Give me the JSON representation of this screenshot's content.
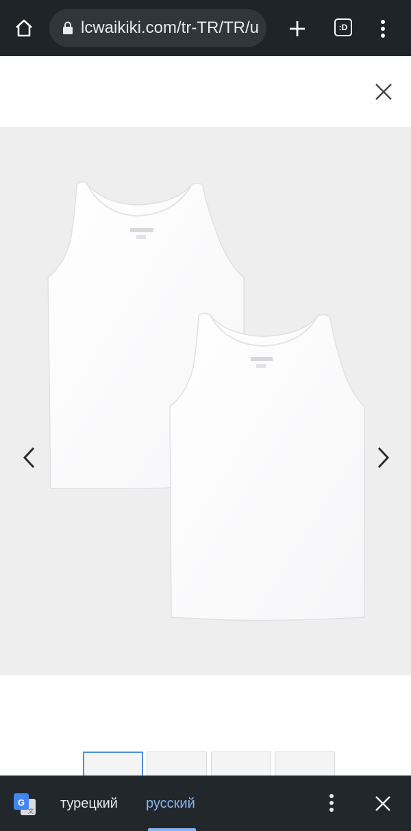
{
  "browser": {
    "url": "lcwaikiki.com/tr-TR/TR/u",
    "tab_count": ":D",
    "icons": [
      "home-icon",
      "lock-icon",
      "plus-icon",
      "tabs-icon",
      "more-vert-icon"
    ]
  },
  "modal": {
    "close_icon": "close-icon"
  },
  "gallery": {
    "product_image": "two white tank tops",
    "prev_icon": "chevron-left-icon",
    "next_icon": "chevron-right-icon",
    "thumbnail_count": 4,
    "active_thumbnail": 1
  },
  "translate_bar": {
    "source_language": "турецкий",
    "target_language": "русский",
    "accent_color": "#8ab4f8"
  }
}
